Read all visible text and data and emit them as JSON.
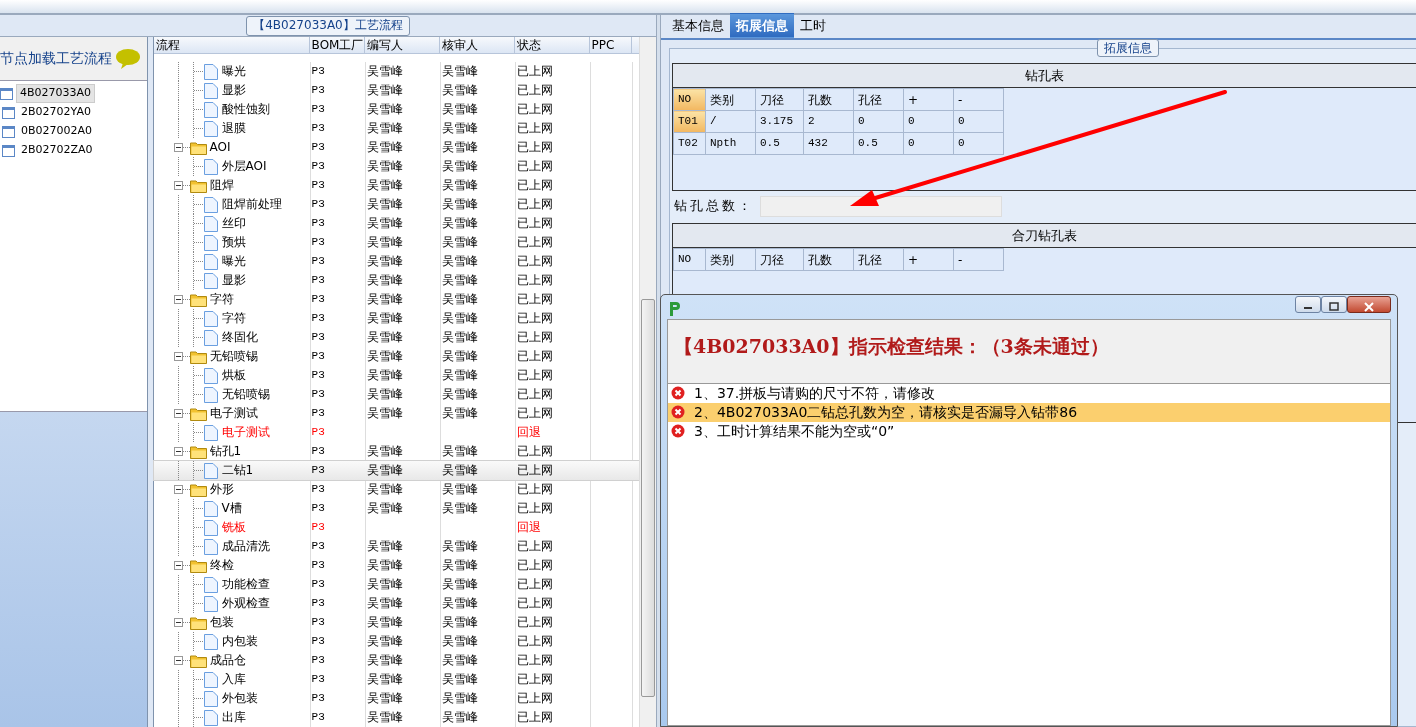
{
  "left_panel": {
    "title": "【4B027033A0】工艺流程",
    "node_header": "节点加载工艺流程",
    "nodes": [
      {
        "label": "4B027033A0",
        "selected": true
      },
      {
        "label": "2B02702YA0",
        "selected": false
      },
      {
        "label": "0B027002A0",
        "selected": false
      },
      {
        "label": "2B02702ZA0",
        "selected": false
      }
    ],
    "grid": {
      "columns": [
        "流程",
        "BOM工厂",
        "编写人",
        "核审人",
        "状态",
        "PPC"
      ],
      "rows": [
        {
          "children": [
            {
              "label": "曝光",
              "bom": "P3",
              "writer": "吴雪峰",
              "reviewer": "吴雪峰",
              "status": "已上网",
              "returned": false,
              "selected": false
            },
            {
              "label": "显影",
              "bom": "P3",
              "writer": "吴雪峰",
              "reviewer": "吴雪峰",
              "status": "已上网",
              "returned": false,
              "selected": false
            },
            {
              "label": "酸性蚀刻",
              "bom": "P3",
              "writer": "吴雪峰",
              "reviewer": "吴雪峰",
              "status": "已上网",
              "returned": false,
              "selected": false
            },
            {
              "label": "退膜",
              "bom": "P3",
              "writer": "吴雪峰",
              "reviewer": "吴雪峰",
              "status": "已上网",
              "returned": false,
              "selected": false
            }
          ]
        },
        {
          "label": "AOI",
          "bom": "P3",
          "writer": "吴雪峰",
          "reviewer": "吴雪峰",
          "status": "已上网",
          "returned": false,
          "selected": false,
          "expanded": true,
          "children": [
            {
              "label": "外层AOI",
              "bom": "P3",
              "writer": "吴雪峰",
              "reviewer": "吴雪峰",
              "status": "已上网",
              "returned": false,
              "selected": false
            }
          ]
        },
        {
          "label": "阻焊",
          "bom": "P3",
          "writer": "吴雪峰",
          "reviewer": "吴雪峰",
          "status": "已上网",
          "returned": false,
          "selected": false,
          "expanded": true,
          "children": [
            {
              "label": "阻焊前处理",
              "bom": "P3",
              "writer": "吴雪峰",
              "reviewer": "吴雪峰",
              "status": "已上网",
              "returned": false,
              "selected": false
            },
            {
              "label": "丝印",
              "bom": "P3",
              "writer": "吴雪峰",
              "reviewer": "吴雪峰",
              "status": "已上网",
              "returned": false,
              "selected": false
            },
            {
              "label": "预烘",
              "bom": "P3",
              "writer": "吴雪峰",
              "reviewer": "吴雪峰",
              "status": "已上网",
              "returned": false,
              "selected": false
            },
            {
              "label": "曝光",
              "bom": "P3",
              "writer": "吴雪峰",
              "reviewer": "吴雪峰",
              "status": "已上网",
              "returned": false,
              "selected": false
            },
            {
              "label": "显影",
              "bom": "P3",
              "writer": "吴雪峰",
              "reviewer": "吴雪峰",
              "status": "已上网",
              "returned": false,
              "selected": false
            }
          ]
        },
        {
          "label": "字符",
          "bom": "P3",
          "writer": "吴雪峰",
          "reviewer": "吴雪峰",
          "status": "已上网",
          "returned": false,
          "selected": false,
          "expanded": true,
          "children": [
            {
              "label": "字符",
              "bom": "P3",
              "writer": "吴雪峰",
              "reviewer": "吴雪峰",
              "status": "已上网",
              "returned": false,
              "selected": false
            },
            {
              "label": "终固化",
              "bom": "P3",
              "writer": "吴雪峰",
              "reviewer": "吴雪峰",
              "status": "已上网",
              "returned": false,
              "selected": false
            }
          ]
        },
        {
          "label": "无铅喷锡",
          "bom": "P3",
          "writer": "吴雪峰",
          "reviewer": "吴雪峰",
          "status": "已上网",
          "returned": false,
          "selected": false,
          "expanded": true,
          "children": [
            {
              "label": "烘板",
              "bom": "P3",
              "writer": "吴雪峰",
              "reviewer": "吴雪峰",
              "status": "已上网",
              "returned": false,
              "selected": false
            },
            {
              "label": "无铅喷锡",
              "bom": "P3",
              "writer": "吴雪峰",
              "reviewer": "吴雪峰",
              "status": "已上网",
              "returned": false,
              "selected": false
            }
          ]
        },
        {
          "label": "电子测试",
          "bom": "P3",
          "writer": "吴雪峰",
          "reviewer": "吴雪峰",
          "status": "已上网",
          "returned": false,
          "selected": false,
          "expanded": true,
          "children": [
            {
              "label": "电子测试",
              "bom": "P3",
              "status": "回退",
              "returned": true,
              "selected": false
            }
          ]
        },
        {
          "label": "钻孔1",
          "bom": "P3",
          "writer": "吴雪峰",
          "reviewer": "吴雪峰",
          "status": "已上网",
          "returned": false,
          "selected": false,
          "expanded": true,
          "children": [
            {
              "label": "二钻1",
              "bom": "P3",
              "writer": "吴雪峰",
              "reviewer": "吴雪峰",
              "status": "已上网",
              "returned": false,
              "selected": true
            }
          ]
        },
        {
          "label": "外形",
          "bom": "P3",
          "writer": "吴雪峰",
          "reviewer": "吴雪峰",
          "status": "已上网",
          "returned": false,
          "selected": false,
          "expanded": true,
          "children": [
            {
              "label": "V槽",
              "bom": "P3",
              "writer": "吴雪峰",
              "reviewer": "吴雪峰",
              "status": "已上网",
              "returned": false,
              "selected": false
            },
            {
              "label": "铣板",
              "bom": "P3",
              "status": "回退",
              "returned": true,
              "selected": false
            },
            {
              "label": "成品清洗",
              "bom": "P3",
              "writer": "吴雪峰",
              "reviewer": "吴雪峰",
              "status": "已上网",
              "returned": false,
              "selected": false
            }
          ]
        },
        {
          "label": "终检",
          "bom": "P3",
          "writer": "吴雪峰",
          "reviewer": "吴雪峰",
          "status": "已上网",
          "returned": false,
          "selected": false,
          "expanded": true,
          "children": [
            {
              "label": "功能检查",
              "bom": "P3",
              "writer": "吴雪峰",
              "reviewer": "吴雪峰",
              "status": "已上网",
              "returned": false,
              "selected": false
            },
            {
              "label": "外观检查",
              "bom": "P3",
              "writer": "吴雪峰",
              "reviewer": "吴雪峰",
              "status": "已上网",
              "returned": false,
              "selected": false
            }
          ]
        },
        {
          "label": "包装",
          "bom": "P3",
          "writer": "吴雪峰",
          "reviewer": "吴雪峰",
          "status": "已上网",
          "returned": false,
          "selected": false,
          "expanded": true,
          "children": [
            {
              "label": "内包装",
              "bom": "P3",
              "writer": "吴雪峰",
              "reviewer": "吴雪峰",
              "status": "已上网",
              "returned": false,
              "selected": false
            }
          ]
        },
        {
          "label": "成品仓",
          "bom": "P3",
          "writer": "吴雪峰",
          "reviewer": "吴雪峰",
          "status": "已上网",
          "returned": false,
          "selected": false,
          "expanded": true,
          "children": [
            {
              "label": "入库",
              "bom": "P3",
              "writer": "吴雪峰",
              "reviewer": "吴雪峰",
              "status": "已上网",
              "returned": false,
              "selected": false
            },
            {
              "label": "外包装",
              "bom": "P3",
              "writer": "吴雪峰",
              "reviewer": "吴雪峰",
              "status": "已上网",
              "returned": false,
              "selected": false
            },
            {
              "label": "出库",
              "bom": "P3",
              "writer": "吴雪峰",
              "reviewer": "吴雪峰",
              "status": "已上网",
              "returned": false,
              "selected": false
            }
          ]
        }
      ]
    }
  },
  "right_panel": {
    "tabs": [
      {
        "label": "基本信息",
        "selected": false
      },
      {
        "label": "拓展信息",
        "selected": true
      },
      {
        "label": "工时",
        "selected": false
      }
    ],
    "fieldset_title": "拓展信息",
    "drill_table": {
      "title": "钻孔表",
      "columns": [
        "NO",
        "类别",
        "刀径",
        "孔数",
        "孔径",
        "+",
        "-"
      ],
      "rows": [
        [
          "T01",
          "/",
          "3.175",
          "2",
          "0",
          "0",
          "0"
        ],
        [
          "T02",
          "Npth",
          "0.5",
          "432",
          "0.5",
          "0",
          "0"
        ]
      ]
    },
    "total_label": "钻孔总数：",
    "merged_table": {
      "title": "合刀钻孔表",
      "columns": [
        "NO",
        "类别",
        "刀径",
        "孔数",
        "孔径",
        "+",
        "-"
      ]
    }
  },
  "dialog": {
    "heading": "【4B027033A0】指示检查结果：（3条未通过）",
    "results": [
      {
        "text": "1、37.拼板与请购的尺寸不符，请修改",
        "selected": false
      },
      {
        "text": "2、4B027033A0二钻总孔数为空，请核实是否漏导入钻带86",
        "selected": true
      },
      {
        "text": "3、工时计算结果不能为空或“0”",
        "selected": false
      }
    ]
  }
}
